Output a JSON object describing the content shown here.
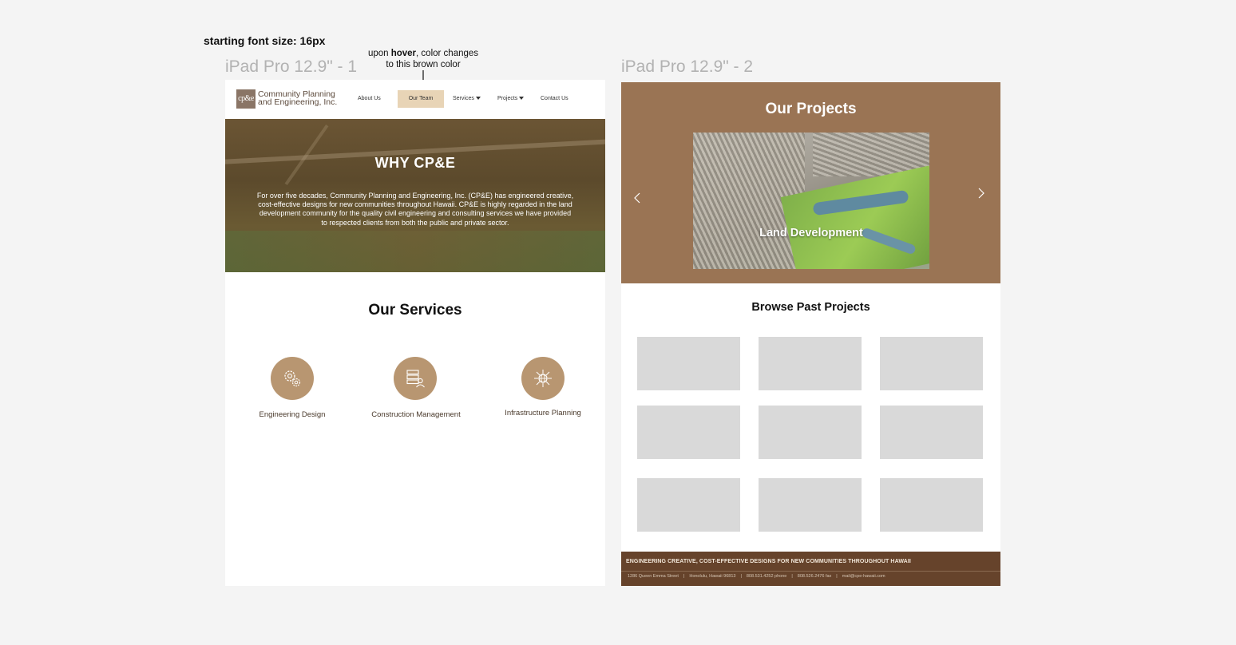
{
  "annotations": {
    "font_note": "starting font size: 16px",
    "frame1_label": "iPad Pro 12.9\" - 1",
    "frame2_label": "iPad Pro 12.9\" - 2",
    "hover_note_pre": "upon ",
    "hover_note_bold": "hover",
    "hover_note_post": ", color changes",
    "hover_note_line2": "to this brown color"
  },
  "header": {
    "logo_mark": "cp&e",
    "logo_line1": "Community Planning",
    "logo_line2": "and Engineering, Inc.",
    "nav": {
      "about": "About Us",
      "team": "Our Team",
      "services": "Services",
      "projects": "Projects",
      "contact": "Contact Us"
    }
  },
  "hero": {
    "title": "WHY CP&E",
    "text": "For over five decades, Community Planning and Engineering, Inc. (CP&E) has engineered creative, cost-effective designs for new communities throughout Hawaii. CP&E is highly regarded in the land development community for the quality civil engineering and consulting services we have provided to respected clients from both the public and private sector."
  },
  "services": {
    "title": "Our Services",
    "items": [
      {
        "label": "Engineering Design",
        "icon": "gears-icon"
      },
      {
        "label": "Construction Management",
        "icon": "server-person-icon"
      },
      {
        "label": "Infrastructure Planning",
        "icon": "network-globe-icon"
      }
    ]
  },
  "projects": {
    "title": "Our Projects",
    "carousel_caption": "Land Development",
    "browse_title": "Browse Past Projects"
  },
  "footer": {
    "tagline": "ENGINEERING CREATIVE, COST-EFFECTIVE DESIGNS FOR NEW COMMUNITIES THROUGHOUT HAWAII",
    "address": "1286 Queen Emma Street",
    "city": "Honolulu, Hawaii 96813",
    "phone": "808.531.4252 phone",
    "fax": "808.526.2476 fax",
    "email": "mail@cpe-hawaii.com",
    "separator": "|"
  },
  "colors": {
    "hover_brown": "#e8d4b6",
    "service_circle": "#b89671",
    "projects_banner": "#9a7454",
    "footer": "#66432b",
    "placeholder_tile": "#d9d9d9"
  }
}
